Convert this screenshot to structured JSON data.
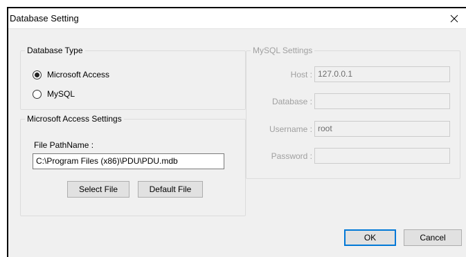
{
  "window": {
    "title": "Database Setting"
  },
  "database_type": {
    "title": "Database Type",
    "options": [
      {
        "label": "Microsoft Access",
        "selected": true
      },
      {
        "label": "MySQL",
        "selected": false
      }
    ]
  },
  "access_settings": {
    "title": "Microsoft Access Settings",
    "file_label": "File PathName :",
    "file_value": "C:\\Program Files (x86)\\PDU\\PDU.mdb",
    "select_file": "Select File",
    "default_file": "Default File"
  },
  "mysql_settings": {
    "title": "MySQL Settings",
    "enabled": false,
    "host_label": "Host :",
    "host_value": "127.0.0.1",
    "database_label": "Database :",
    "database_value": "",
    "username_label": "Username :",
    "username_value": "root",
    "password_label": "Password :",
    "password_value": ""
  },
  "buttons": {
    "ok": "OK",
    "cancel": "Cancel"
  },
  "colors": {
    "default_button_border": "#0078d7",
    "disabled_text": "#a0a0a0"
  },
  "icons": {
    "close": "close-icon"
  }
}
